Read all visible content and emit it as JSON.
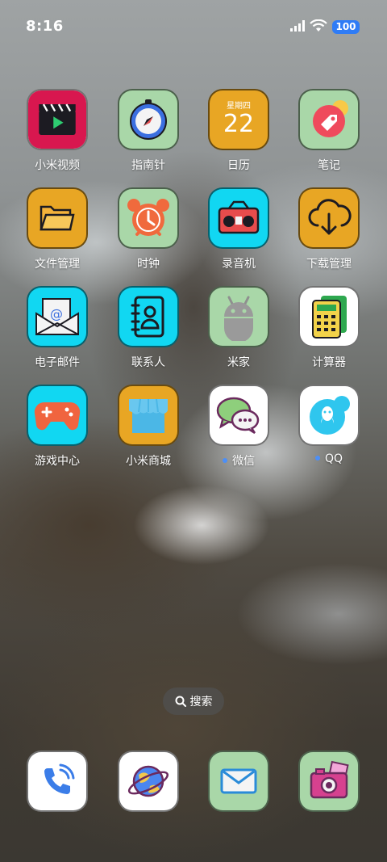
{
  "status": {
    "time": "8:16",
    "battery": "100"
  },
  "apps": [
    {
      "label": "小米视频",
      "icon": "video-icon",
      "bg": "#ffffff"
    },
    {
      "label": "指南针",
      "icon": "compass-icon",
      "bg": "#a9d7a8"
    },
    {
      "label": "日历",
      "icon": "calendar-icon",
      "bg": "#e8a624",
      "weekday": "星期四",
      "day": "22"
    },
    {
      "label": "笔记",
      "icon": "notes-icon",
      "bg": "#a9d7a8"
    },
    {
      "label": "文件管理",
      "icon": "folder-icon",
      "bg": "#e8a624"
    },
    {
      "label": "时钟",
      "icon": "alarm-clock-icon",
      "bg": "#a9d7a8"
    },
    {
      "label": "录音机",
      "icon": "radio-recorder-icon",
      "bg": "#11d7f2"
    },
    {
      "label": "下载管理",
      "icon": "download-icon",
      "bg": "#e8a624"
    },
    {
      "label": "电子邮件",
      "icon": "email-icon",
      "bg": "#11d7f2"
    },
    {
      "label": "联系人",
      "icon": "contacts-icon",
      "bg": "#11d7f2"
    },
    {
      "label": "米家",
      "icon": "android-robot-icon",
      "bg": "#a9d7a8"
    },
    {
      "label": "计算器",
      "icon": "calculator-icon",
      "bg": "#ffffff"
    },
    {
      "label": "游戏中心",
      "icon": "gamepad-icon",
      "bg": "#11d7f2"
    },
    {
      "label": "小米商城",
      "icon": "store-icon",
      "bg": "#e8a624"
    },
    {
      "label": "微信",
      "icon": "wechat-icon",
      "bg": "#ffffff",
      "new": true
    },
    {
      "label": "QQ",
      "icon": "qq-icon",
      "bg": "#ffffff",
      "new": true
    }
  ],
  "search": {
    "label": "搜索"
  },
  "dock": [
    {
      "icon": "phone-icon",
      "bg": "#ffffff"
    },
    {
      "icon": "browser-globe-icon",
      "bg": "#ffffff"
    },
    {
      "icon": "messages-icon",
      "bg": "#a9d7a8"
    },
    {
      "icon": "camera-icon",
      "bg": "#a9d7a8"
    }
  ]
}
